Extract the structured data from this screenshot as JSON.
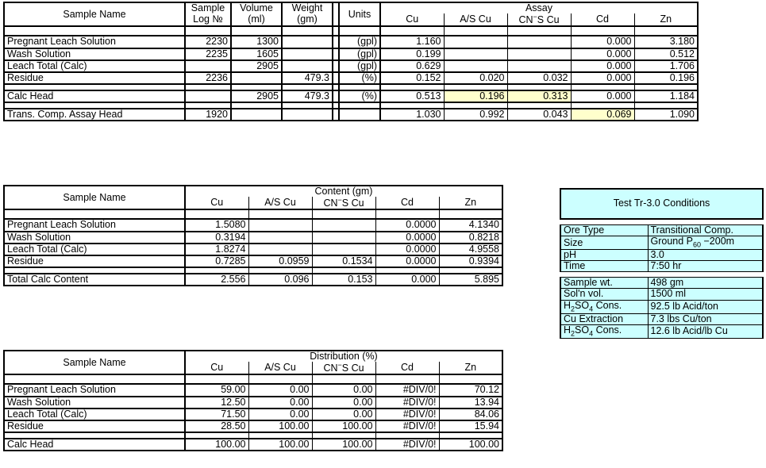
{
  "assay_table": {
    "headers": {
      "sample_name": "Sample Name",
      "sample_log": "Sample",
      "sample_log2": "Log №",
      "volume": "Volume",
      "volume2": "(ml)",
      "weight": "Weight",
      "weight2": "(gm)",
      "units": "Units",
      "assay_group": "Assay",
      "cu": "Cu",
      "as_cu": "A/S Cu",
      "cns_cu_a": "CN",
      "cns_cu_b": "−",
      "cns_cu_c": "S Cu",
      "cd": "Cd",
      "zn": "Zn"
    },
    "rows": [
      {
        "name": "Pregnant Leach Solution",
        "log": "2230",
        "volume": "1300",
        "weight": "",
        "units": "(gpl)",
        "cu": "1.160",
        "as_cu": "",
        "cns_cu": "",
        "cd": "0.000",
        "zn": "3.180",
        "bold": false,
        "hl": []
      },
      {
        "name": "Wash Solution",
        "log": "2235",
        "volume": "1605",
        "weight": "",
        "units": "(gpl)",
        "cu": "0.199",
        "as_cu": "",
        "cns_cu": "",
        "cd": "0.000",
        "zn": "0.512",
        "bold": false,
        "hl": []
      },
      {
        "name": "Leach Total (Calc)",
        "log": "",
        "volume": "2905",
        "weight": "",
        "units": "(gpl)",
        "cu": "0.629",
        "as_cu": "",
        "cns_cu": "",
        "cd": "0.000",
        "zn": "1.706",
        "bold": false,
        "hl": []
      },
      {
        "name": "Residue",
        "log": "2236",
        "volume": "",
        "weight": "479.3",
        "units": "(%)",
        "cu": "0.152",
        "as_cu": "0.020",
        "cns_cu": "0.032",
        "cd": "0.000",
        "zn": "0.196",
        "bold": false,
        "hl": []
      },
      {
        "name": "Calc Head",
        "log": "",
        "volume": "2905",
        "weight": "479.3",
        "units": "(%)",
        "cu": "0.513",
        "as_cu": "0.196",
        "cns_cu": "0.313",
        "cd": "0.000",
        "zn": "1.184",
        "bold": true,
        "hl": [
          "as_cu",
          "cns_cu"
        ]
      },
      {
        "name": "Trans. Comp. Assay Head",
        "log": "1920",
        "volume": "",
        "weight": "",
        "units": "",
        "cu": "1.030",
        "as_cu": "0.992",
        "cns_cu": "0.043",
        "cd": "0.069",
        "zn": "1.090",
        "bold": true,
        "hl": [
          "cd"
        ]
      }
    ]
  },
  "content_table": {
    "headers": {
      "sample_name": "Sample Name",
      "group": "Content (gm)",
      "cu": "Cu",
      "as_cu": "A/S Cu",
      "cns_cu_a": "CN",
      "cns_cu_b": "−",
      "cns_cu_c": "S Cu",
      "cd": "Cd",
      "zn": "Zn"
    },
    "rows": [
      {
        "name": "Pregnant Leach Solution",
        "cu": "1.5080",
        "as_cu": "",
        "cns_cu": "",
        "cd": "0.0000",
        "zn": "4.1340",
        "bold": false
      },
      {
        "name": "Wash Solution",
        "cu": "0.3194",
        "as_cu": "",
        "cns_cu": "",
        "cd": "0.0000",
        "zn": "0.8218",
        "bold": false
      },
      {
        "name": "Leach Total (Calc)",
        "cu": "1.8274",
        "as_cu": "",
        "cns_cu": "",
        "cd": "0.0000",
        "zn": "4.9558",
        "bold": false
      },
      {
        "name": "Residue",
        "cu": "0.7285",
        "as_cu": "0.0959",
        "cns_cu": "0.1534",
        "cd": "0.0000",
        "zn": "0.9394",
        "bold": false
      },
      {
        "name": "Total Calc Content",
        "cu": "2.556",
        "as_cu": "0.096",
        "cns_cu": "0.153",
        "cd": "0.000",
        "zn": "5.895",
        "bold": true
      }
    ]
  },
  "distribution_table": {
    "headers": {
      "sample_name": "Sample Name",
      "group": "Distribution (%)",
      "cu": "Cu",
      "as_cu": "A/S Cu",
      "cns_cu_a": "CN",
      "cns_cu_b": "−",
      "cns_cu_c": "S Cu",
      "cd": "Cd",
      "zn": "Zn"
    },
    "rows": [
      {
        "name": "Pregnant Leach Solution",
        "cu": "59.00",
        "as_cu": "0.00",
        "cns_cu": "0.00",
        "cd": "#DIV/0!",
        "zn": "70.12",
        "bold": false
      },
      {
        "name": "Wash Solution",
        "cu": "12.50",
        "as_cu": "0.00",
        "cns_cu": "0.00",
        "cd": "#DIV/0!",
        "zn": "13.94",
        "bold": false
      },
      {
        "name": "Leach Total (Calc)",
        "cu": "71.50",
        "as_cu": "0.00",
        "cns_cu": "0.00",
        "cd": "#DIV/0!",
        "zn": "84.06",
        "bold": false
      },
      {
        "name": "Residue",
        "cu": "28.50",
        "as_cu": "100.00",
        "cns_cu": "100.00",
        "cd": "#DIV/0!",
        "zn": "15.94",
        "bold": false
      },
      {
        "name": "Calc Head",
        "cu": "100.00",
        "as_cu": "100.00",
        "cns_cu": "100.00",
        "cd": "#DIV/0!",
        "zn": "100.00",
        "bold": true
      }
    ]
  },
  "conditions_panel": {
    "title": "Test Tr-3.0 Conditions",
    "rows": [
      {
        "label": "Ore Type",
        "value": "Transitional Comp."
      },
      {
        "label": "Size",
        "value_pre": "Ground P",
        "value_sub": "60",
        "value_post": " −200m"
      },
      {
        "label": "pH",
        "value": "3.0"
      },
      {
        "label": "Time",
        "value": "7:50 hr"
      }
    ],
    "rows2": [
      {
        "label": "Sample wt.",
        "value": "498 gm"
      },
      {
        "label": "Sol'n vol.",
        "value": "1500 ml"
      },
      {
        "label_pre": "H",
        "label_sub": "2",
        "label_mid": "SO",
        "label_sub2": "4",
        "label_post": " Cons.",
        "value": "92.5 lb Acid/ton"
      },
      {
        "label": "Cu Extraction",
        "value": "7.3 lbs Cu/ton"
      },
      {
        "label_pre": "H",
        "label_sub": "2",
        "label_mid": "SO",
        "label_sub2": "4",
        "label_post": " Cons.",
        "value": "12.6 lb Acid/lb Cu"
      }
    ]
  },
  "colors": {
    "highlight_yellow": "#ffffcc",
    "panel_cyan": "#ccffff",
    "grid": "#000000"
  }
}
